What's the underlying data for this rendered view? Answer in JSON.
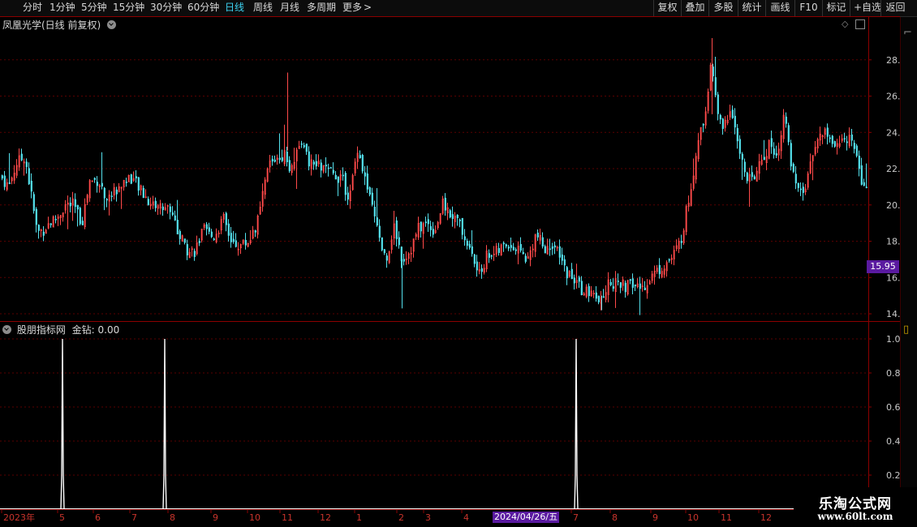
{
  "toolbar": {
    "periods": [
      "分时",
      "1分钟",
      "5分钟",
      "15分钟",
      "30分钟",
      "60分钟",
      "日线",
      "周线",
      "月线",
      "多周期",
      "更多"
    ],
    "more_symbol": ">",
    "active_period": "日线",
    "right_buttons": [
      "复权",
      "叠加",
      "多股",
      "统计",
      "画线",
      "F10",
      "标记",
      "+自选",
      "返回"
    ]
  },
  "main_panel": {
    "title": "凤凰光学(日线 前复权)",
    "price_axis_labels": [
      "28.00",
      "26.00",
      "24.00",
      "22.00",
      "20.00",
      "18.00",
      "16.00",
      "14.00"
    ],
    "current_price": "15.95",
    "colors": {
      "up": "#ff4a4a",
      "down": "#54e0ec",
      "grid": "#5a0000",
      "border": "#8c0000"
    }
  },
  "indicator_panel": {
    "title": "股朋指标网",
    "value_text": "金钻: 0.00",
    "axis_labels": [
      "1.00",
      "0.80",
      "0.60",
      "0.40",
      "0.20"
    ],
    "signal_color": "#ffffff"
  },
  "time_axis": {
    "labels": [
      "2023年",
      "5",
      "6",
      "7",
      "8",
      "9",
      "10",
      "11",
      "12",
      "1",
      "2",
      "3",
      "4",
      "7",
      "8",
      "9",
      "10",
      "11",
      "12"
    ],
    "cursor_date": "2024/04/26/五"
  },
  "watermark": {
    "title": "乐淘公式网",
    "url": "www.60lt.com"
  },
  "chart_data": {
    "type": "candlestick",
    "title": "凤凰光学(日线 前复权)",
    "y_range": [
      13.6,
      29.6
    ],
    "y_ticks": [
      28,
      26,
      24,
      22,
      20,
      18,
      16,
      14
    ],
    "anchors_close": [
      [
        0,
        21.6
      ],
      [
        10,
        21.0
      ],
      [
        20,
        22.3
      ],
      [
        30,
        22.7
      ],
      [
        38,
        20.5
      ],
      [
        45,
        18.5
      ],
      [
        52,
        18.6
      ],
      [
        60,
        19.0
      ],
      [
        70,
        19.3
      ],
      [
        80,
        20.0
      ],
      [
        90,
        20.0
      ],
      [
        100,
        19.0
      ],
      [
        110,
        21.3
      ],
      [
        120,
        21.4
      ],
      [
        132,
        20.3
      ],
      [
        145,
        21.0
      ],
      [
        160,
        21.6
      ],
      [
        172,
        20.8
      ],
      [
        185,
        20.1
      ],
      [
        198,
        19.9
      ],
      [
        210,
        19.8
      ],
      [
        220,
        18.4
      ],
      [
        232,
        17.4
      ],
      [
        240,
        17.5
      ],
      [
        250,
        18.6
      ],
      [
        262,
        18.2
      ],
      [
        275,
        19.2
      ],
      [
        285,
        17.9
      ],
      [
        296,
        17.8
      ],
      [
        306,
        18.0
      ],
      [
        318,
        19.2
      ],
      [
        330,
        22.2
      ],
      [
        342,
        22.7
      ],
      [
        350,
        22.8
      ],
      [
        358,
        22.0
      ],
      [
        368,
        23.5
      ],
      [
        382,
        22.2
      ],
      [
        395,
        22.1
      ],
      [
        408,
        21.7
      ],
      [
        420,
        21.5
      ],
      [
        430,
        20.3
      ],
      [
        440,
        23.2
      ],
      [
        455,
        20.3
      ],
      [
        465,
        18.5
      ],
      [
        475,
        16.9
      ],
      [
        485,
        18.9
      ],
      [
        495,
        17.0
      ],
      [
        505,
        17.5
      ],
      [
        515,
        18.7
      ],
      [
        525,
        19.0
      ],
      [
        535,
        18.6
      ],
      [
        545,
        20.0
      ],
      [
        555,
        19.5
      ],
      [
        565,
        19.0
      ],
      [
        575,
        17.9
      ],
      [
        590,
        16.1
      ],
      [
        600,
        17.3
      ],
      [
        612,
        17.4
      ],
      [
        625,
        17.9
      ],
      [
        640,
        17.4
      ],
      [
        650,
        17.0
      ],
      [
        660,
        18.4
      ],
      [
        672,
        17.4
      ],
      [
        680,
        17.9
      ],
      [
        695,
        16.5
      ],
      [
        705,
        15.9
      ],
      [
        715,
        15.4
      ],
      [
        725,
        15.1
      ],
      [
        740,
        14.6
      ],
      [
        750,
        15.8
      ],
      [
        760,
        15.6
      ],
      [
        770,
        15.5
      ],
      [
        780,
        15.6
      ],
      [
        790,
        15.4
      ],
      [
        800,
        16.0
      ],
      [
        815,
        16.6
      ],
      [
        828,
        17.1
      ],
      [
        838,
        18.0
      ],
      [
        848,
        20.3
      ],
      [
        858,
        23.0
      ],
      [
        868,
        25.0
      ],
      [
        876,
        27.8
      ],
      [
        882,
        25.5
      ],
      [
        890,
        24.0
      ],
      [
        900,
        25.5
      ],
      [
        910,
        23.0
      ],
      [
        920,
        21.2
      ],
      [
        930,
        21.7
      ],
      [
        940,
        22.4
      ],
      [
        948,
        23.5
      ],
      [
        958,
        22.6
      ],
      [
        965,
        25.3
      ],
      [
        975,
        21.8
      ],
      [
        985,
        20.4
      ],
      [
        995,
        21.4
      ],
      [
        1005,
        23.7
      ],
      [
        1015,
        24.0
      ],
      [
        1025,
        23.5
      ],
      [
        1035,
        23.2
      ],
      [
        1045,
        23.9
      ],
      [
        1055,
        23.0
      ],
      [
        1062,
        20.9
      ],
      [
        1068,
        21.3
      ]
    ],
    "indicator_signals": [
      {
        "x_date": "2023-05",
        "value": 1.0
      },
      {
        "x_date": "2023-08",
        "value": 1.0
      },
      {
        "x_date": "2024-07",
        "value": 1.0
      }
    ]
  }
}
